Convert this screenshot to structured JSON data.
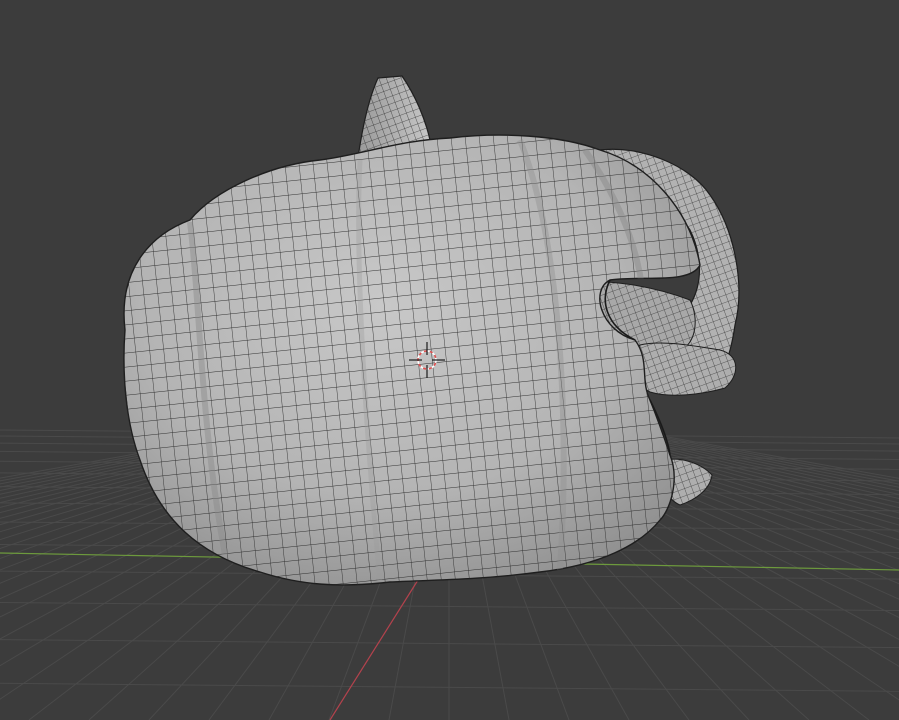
{
  "viewport": {
    "background_color": "#3c3c3c",
    "grid_color": "#4a4a4a",
    "x_axis_color": "#b3424d",
    "y_axis_color": "#6d9a3d",
    "object": {
      "name": "pumpkin",
      "display": "wireframe-on-solid",
      "surface_color": "#bdbdbd",
      "wire_color": "#2a2a2a"
    },
    "cursor": {
      "icon": "3d-cursor-icon",
      "ring_color_a": "#e05050",
      "ring_color_b": "#ffffff"
    }
  }
}
